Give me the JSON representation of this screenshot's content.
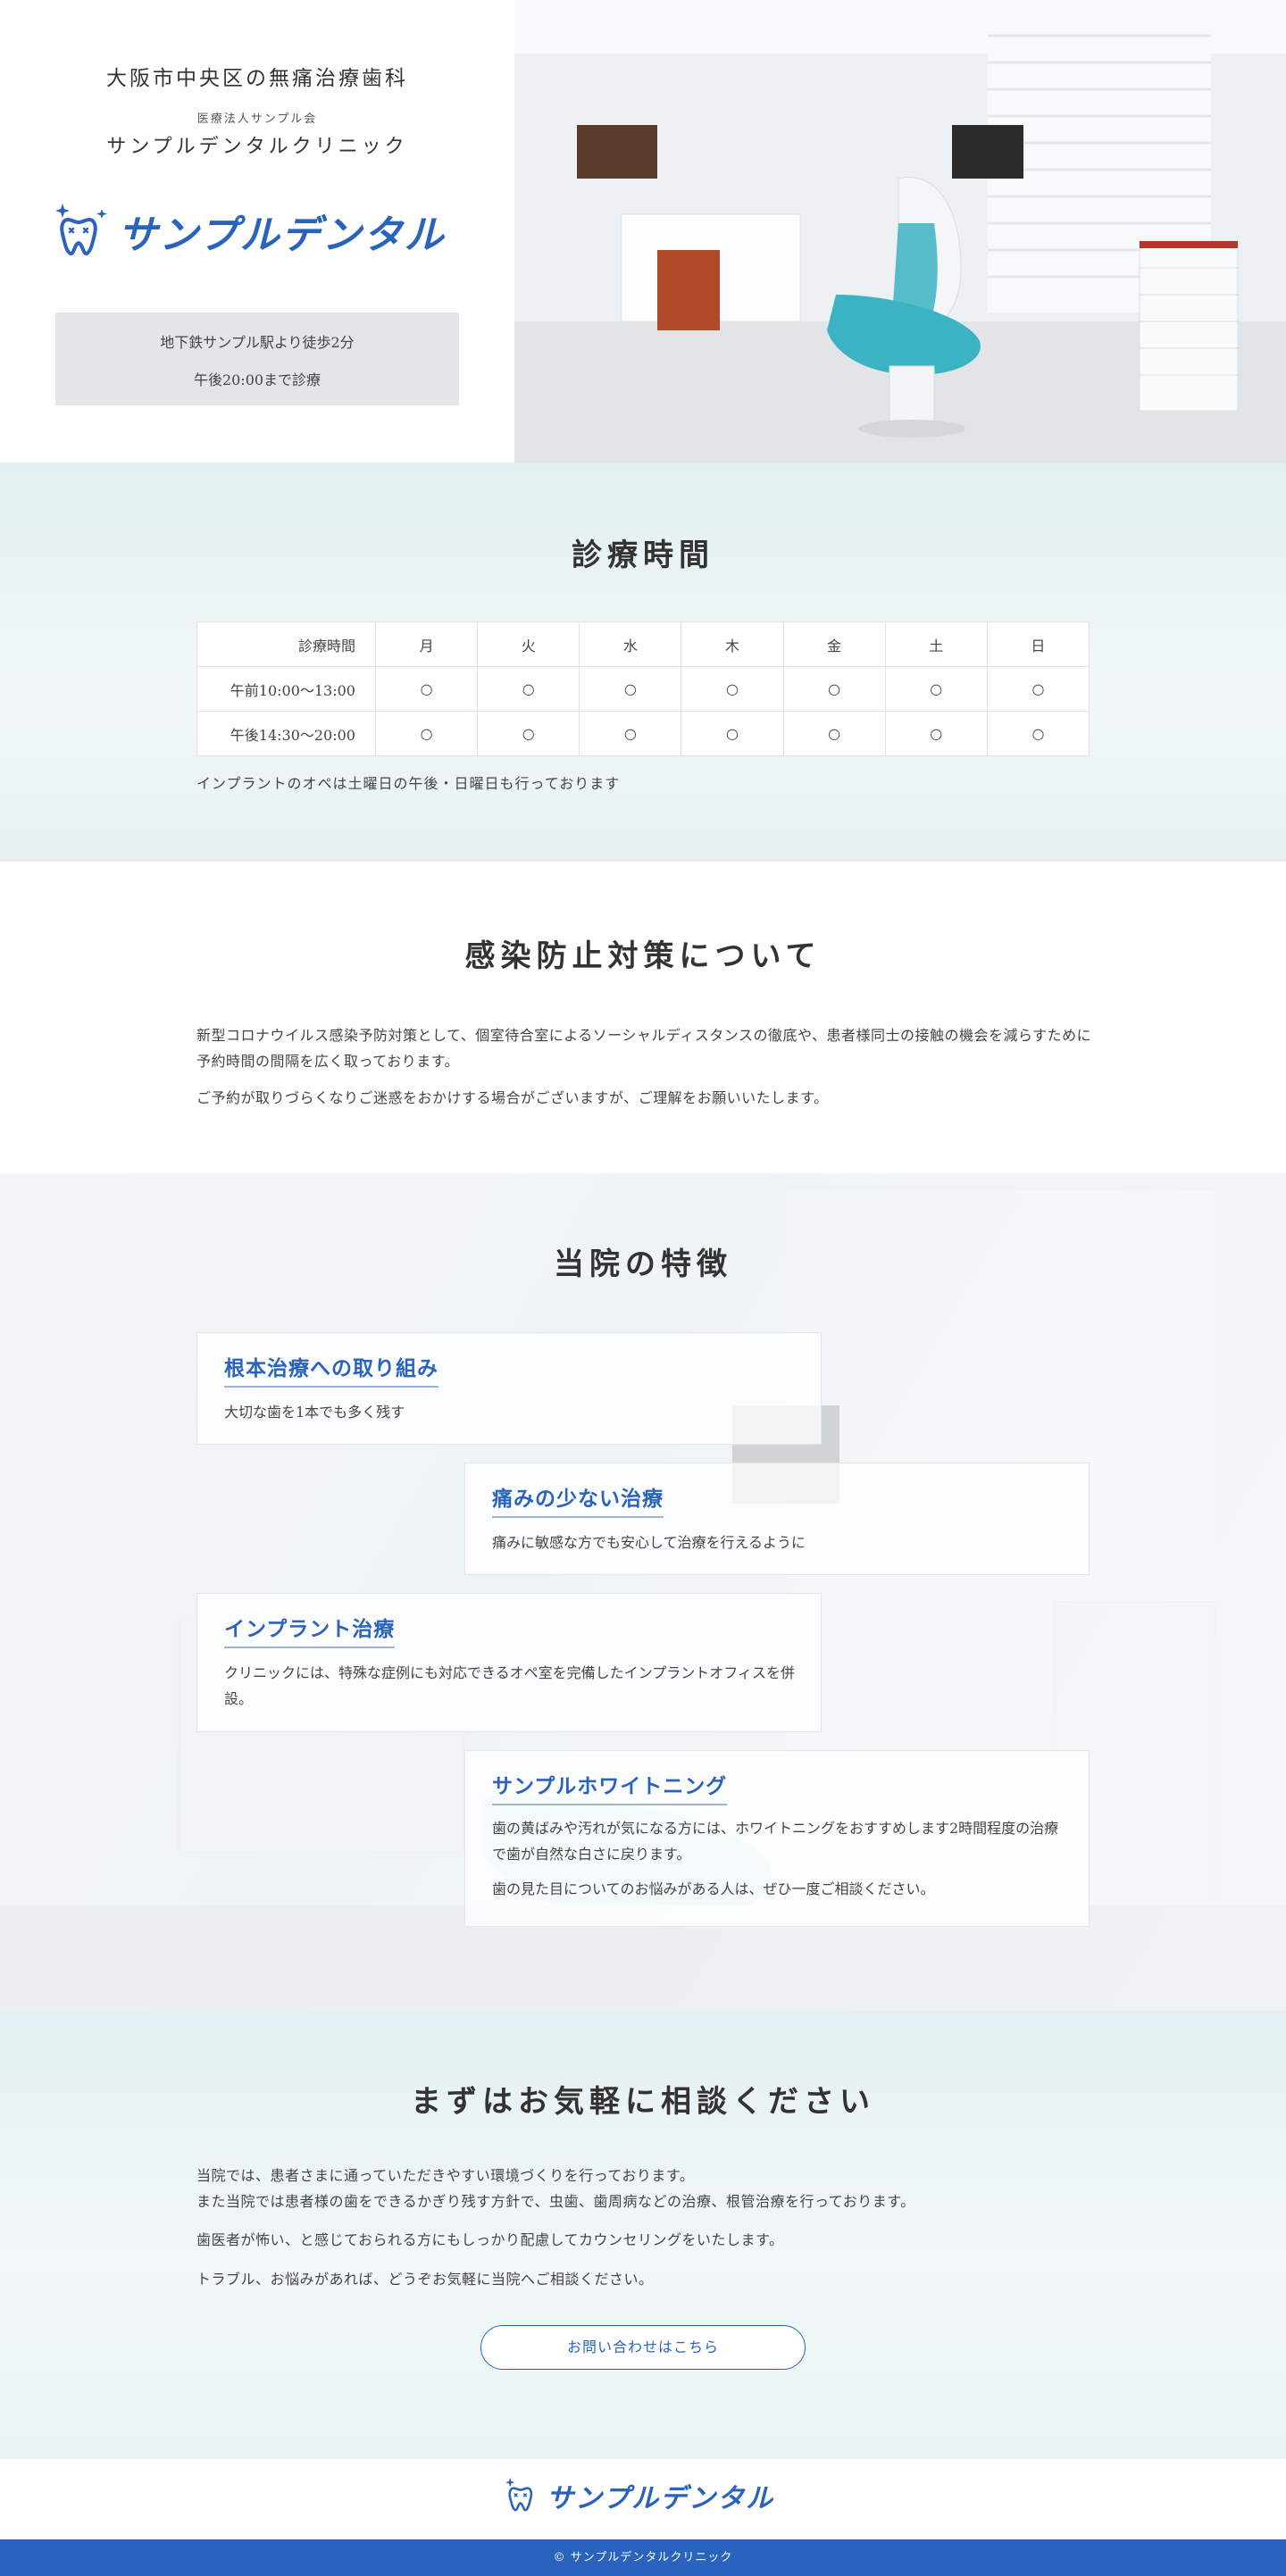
{
  "hero": {
    "lead": "大阪市中央区の無痛治療歯科",
    "corp": "医療法人サンプル会",
    "clinic_name": "サンプルデンタルクリニック",
    "logo_text": "サンプルデンタル",
    "access_line1": "地下鉄サンプル駅より徒歩2分",
    "access_line2": "午後20:00まで診療"
  },
  "hours": {
    "title": "診療時間",
    "header": [
      "診療時間",
      "月",
      "火",
      "水",
      "木",
      "金",
      "土",
      "日"
    ],
    "rows": [
      [
        "午前10:00〜13:00",
        "○",
        "○",
        "○",
        "○",
        "○",
        "○",
        "○"
      ],
      [
        "午後14:30〜20:00",
        "○",
        "○",
        "○",
        "○",
        "○",
        "○",
        "○"
      ]
    ],
    "note": "インプラントのオペは土曜日の午後・日曜日も行っております"
  },
  "infection": {
    "title": "感染防止対策について",
    "p1": "新型コロナウイルス感染予防対策として、個室待合室によるソーシャルディスタンスの徹底や、患者様同士の接触の機会を減らすために予約時間の間隔を広く取っております。",
    "p2": "ご予約が取りづらくなりご迷惑をおかけする場合がございますが、ご理解をお願いいたします。"
  },
  "features": {
    "title": "当院の特徴",
    "items": [
      {
        "title": "根本治療への取り組み",
        "text": "大切な歯を1本でも多く残す"
      },
      {
        "title": "痛みの少ない治療",
        "text": "痛みに敏感な方でも安心して治療を行えるように"
      },
      {
        "title": "インプラント治療",
        "text": "クリニックには、特殊な症例にも対応できるオペ室を完備したインプラントオフィスを併設。"
      },
      {
        "title": "サンプルホワイトニング",
        "text": "歯の黄ばみや汚れが気になる方には、ホワイトニングをおすすめします2時間程度の治療で歯が自然な白さに戻ります。",
        "text2": "歯の見た目についてのお悩みがある人は、ぜひ一度ご相談ください。"
      }
    ]
  },
  "consult": {
    "title": "まずはお気軽に相談ください",
    "p1": "当院では、患者さまに通っていただきやすい環境づくりを行っております。\nまた当院では患者様の歯をできるかぎり残す方針で、虫歯、歯周病などの治療、根管治療を行っております。",
    "p2": "歯医者が怖い、と感じておられる方にもしっかり配慮してカウンセリングをいたします。",
    "p3": "トラブル、お悩みがあれば、どうぞお気軽に当院へご相談ください。",
    "button_label": "お問い合わせはこちら"
  },
  "footer": {
    "logo_text": "サンプルデンタル",
    "copyright": "© サンプルデンタルクリニック"
  },
  "colors": {
    "brand": "#2a63be",
    "teal_accent": "#3bb3c3"
  }
}
